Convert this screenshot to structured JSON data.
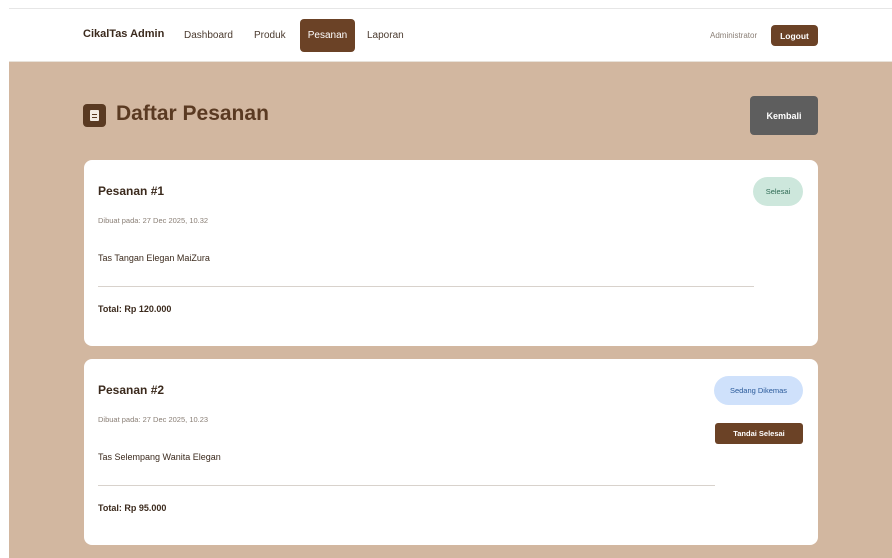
{
  "navbar": {
    "brand": "CikalTas Admin",
    "links": [
      "Dashboard",
      "Produk",
      "Pesanan",
      "Laporan"
    ],
    "active": "Pesanan",
    "user": "Administrator",
    "logout_label": "Logout"
  },
  "page": {
    "title": "Daftar Pesanan",
    "icon": "document-icon",
    "back_label": "Kembali"
  },
  "orders": [
    {
      "title": "Pesanan #1",
      "date": "Dibuat pada: 27 Dec 2025, 10.32",
      "item": "Tas Tangan Elegan MaiZura",
      "total": "Total: Rp 120.000",
      "status": "Selesai",
      "status_color": "#cde7dc"
    },
    {
      "title": "Pesanan #2",
      "date": "Dibuat pada: 27 Dec 2025, 10.23",
      "item": "Tas Selempang Wanita Elegan",
      "total": "Total: Rp 95.000",
      "status": "Sedang Dikemas",
      "status_color": "#cfe1fb",
      "action_label": "Tandai Selesai"
    }
  ],
  "colors": {
    "brand": "#6b4226",
    "background": "#d2b7a0",
    "back_button": "#5e5e5e"
  }
}
